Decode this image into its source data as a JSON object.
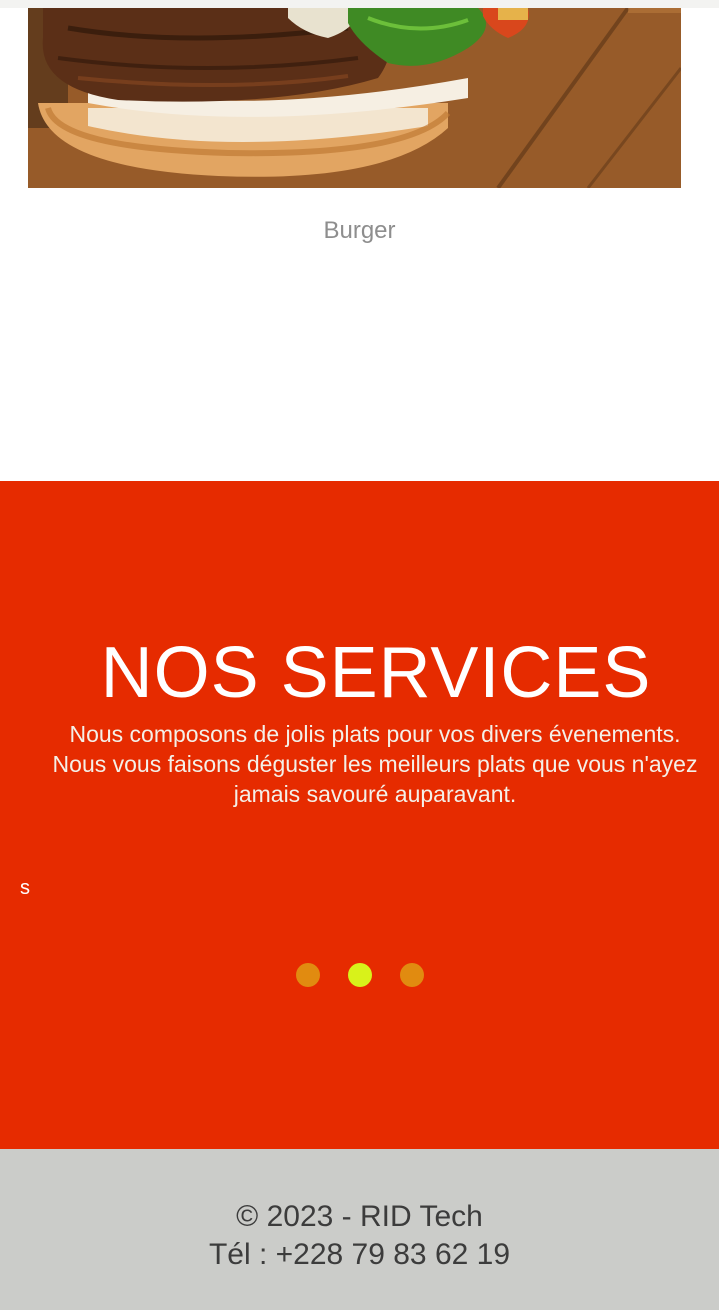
{
  "product": {
    "image_alt": "Burger",
    "name": "Burger"
  },
  "services": {
    "title": "NOS SERVICES",
    "description": "Nous composons de jolis plats pour vos divers évenements. Nous vous faisons déguster les meilleurs plats que vous n'ayez jamais savouré auparavant.",
    "stray_text": "s",
    "background_color": "#e62b00",
    "carousel": {
      "slide_count": 3,
      "active_index": 1,
      "dot_color": "#e18b10",
      "active_dot_color": "#d8f21a"
    }
  },
  "footer": {
    "copyright": "© 2023 - RID Tech",
    "phone": "Tél : +228 79 83 62 19",
    "background_color": "#cbccc9"
  }
}
